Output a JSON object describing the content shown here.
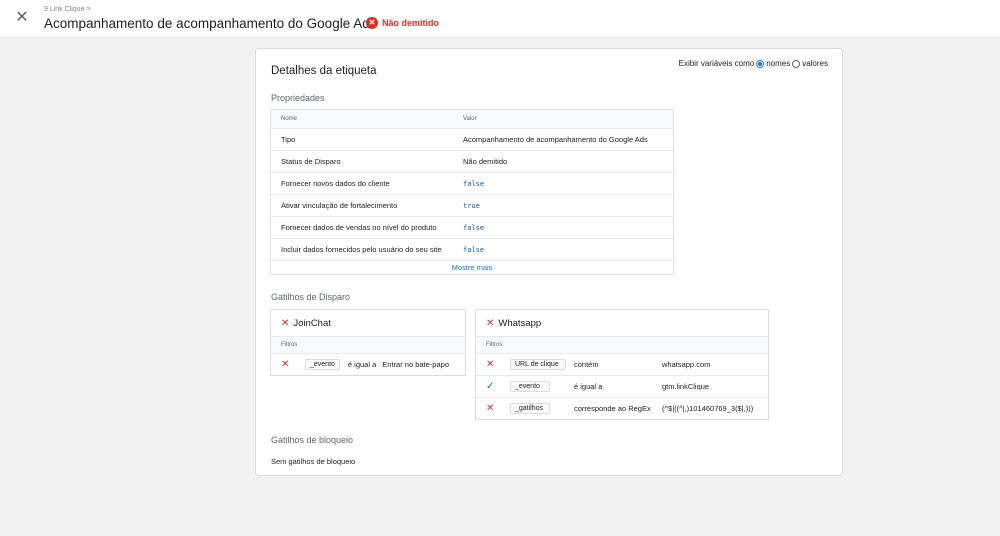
{
  "header": {
    "breadcrumb": "9 Link Clique >",
    "title": "Acompanhamento de acompanhamento do Google Ads",
    "status": "Não demitido",
    "status_color": "#d93025"
  },
  "card": {
    "title": "Detalhes da etiqueta",
    "toggle_label": "Exibir variáveis como",
    "toggle_options": [
      "nomes",
      "valores"
    ],
    "properties_label": "Propriedades",
    "columns": [
      "Nome",
      "Valor"
    ],
    "rows": [
      {
        "name": "Tipo",
        "value": "Acompanhamento de acompanhamento do Google Ads"
      },
      {
        "name": "Status de Disparo",
        "value": "Não demitido"
      },
      {
        "name": "Fornecer novos dados do cliente",
        "value": "false"
      },
      {
        "name": "Ativar vinculação de fortalecimento",
        "value": "true"
      },
      {
        "name": "Fornecer dados de vendas no nível do produto",
        "value": "false"
      },
      {
        "name": "Incluir dados fornecidos pelo usuário do seu site",
        "value": "false"
      }
    ],
    "show_more": "Mostre mais",
    "triggers_label": "Gatilhos de Disparo",
    "trigger1": {
      "name": "JoinChat",
      "filters_label": "Filtros",
      "filters": [
        {
          "status": "x",
          "var": "_evento",
          "op": "é igual a",
          "val": "Entrar no bate-papo"
        }
      ]
    },
    "trigger2": {
      "name": "Whatsapp",
      "filters_label": "Filtros",
      "filters": [
        {
          "status": "x",
          "var": "URL de clique",
          "op": "contém",
          "val": "whatsapp.com"
        },
        {
          "status": "ok",
          "var": "_evento",
          "op": "é igual a",
          "val": "gtm.linkClique"
        },
        {
          "status": "x",
          "var": "_gatilhos",
          "op": "corresponde ao RegEx",
          "val": "(^$|((^|,)101460769_3($|,)))"
        }
      ]
    },
    "blocking_label": "Gatilhos de bloqueio",
    "blocking_value": "Sem gatilhos de bloqueio"
  }
}
